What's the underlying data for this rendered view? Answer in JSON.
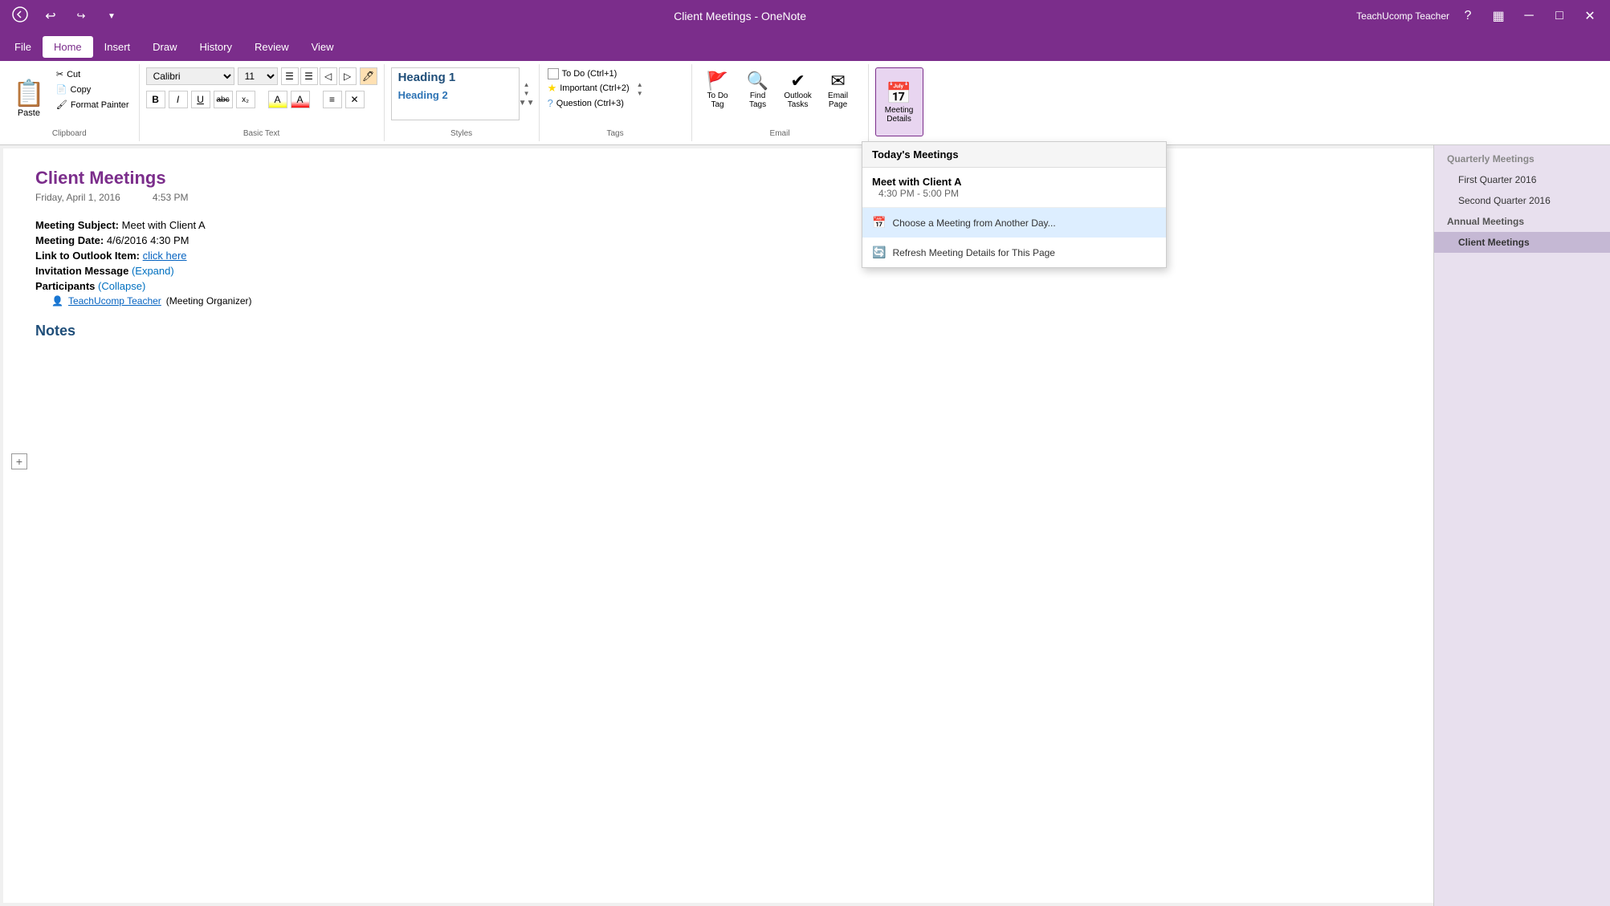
{
  "titlebar": {
    "title": "Client Meetings - OneNote",
    "user": "TeachUcomp Teacher",
    "back_icon": "◀",
    "forward_icon": "▶",
    "undo_icon": "↩",
    "help_icon": "?",
    "layout_icon": "▦",
    "minimize_icon": "─",
    "maximize_icon": "□",
    "close_icon": "✕"
  },
  "menubar": {
    "items": [
      "File",
      "Home",
      "Insert",
      "Draw",
      "History",
      "Review",
      "View"
    ]
  },
  "ribbon": {
    "clipboard": {
      "label": "Clipboard",
      "paste": "Paste",
      "cut": "Cut",
      "copy": "Copy",
      "format_painter": "Format Painter"
    },
    "basic_text": {
      "label": "Basic Text",
      "font": "Calibri",
      "size": "11",
      "bold": "B",
      "italic": "I",
      "underline": "U",
      "strikethrough": "abc",
      "subscript": "x₂",
      "list_bullet": "≡",
      "list_number": "≡",
      "indent_less": "◁",
      "indent_more": "▷",
      "clear_format": "✕",
      "highlight": "A",
      "font_color": "A",
      "align": "≡"
    },
    "styles": {
      "label": "Styles",
      "heading1": "Heading 1",
      "heading2": "Heading 2"
    },
    "tags": {
      "label": "Tags",
      "todo": "To Do (Ctrl+1)",
      "important": "Important (Ctrl+2)",
      "question": "Question (Ctrl+3)"
    },
    "email": {
      "label": "Email",
      "to_do_tag": "To Do\nTag",
      "find_tags": "Find\nTags",
      "outlook_tasks": "Outlook\nTasks",
      "email_page": "Email\nPage"
    },
    "meeting": {
      "label": "",
      "meeting_details": "Meeting\nDetails"
    }
  },
  "page": {
    "title": "Client Meetings",
    "date": "Friday, April 1, 2016",
    "time": "4:53 PM",
    "meeting_subject_label": "Meeting Subject:",
    "meeting_subject": "Meet with Client A",
    "meeting_date_label": "Meeting Date:",
    "meeting_date": "4/6/2016 4:30 PM",
    "outlook_link_label": "Link to Outlook Item:",
    "outlook_link": "click here",
    "invitation_label": "Invitation Message",
    "invitation_expand": "(Expand)",
    "participants_label": "Participants",
    "participants_collapse": "(Collapse)",
    "participant_name": "TeachUcomp Teacher",
    "participant_role": "(Meeting Organizer)",
    "notes_heading": "Notes"
  },
  "dropdown": {
    "header": "Today's Meetings",
    "meeting_title": "Meet with Client A",
    "meeting_time": "4:30 PM - 5:00 PM",
    "choose_label": "Choose a Meeting from Another Day...",
    "refresh_label": "Refresh Meeting Details for This Page"
  },
  "sidebar": {
    "items": [
      {
        "label": "Quarterly Meetings",
        "level": "parent",
        "selected": false
      },
      {
        "label": "First Quarter 2016",
        "level": "sub",
        "selected": false
      },
      {
        "label": "Second Quarter 2016",
        "level": "sub",
        "selected": false
      },
      {
        "label": "Annual Meetings",
        "level": "parent",
        "selected": false
      },
      {
        "label": "Client Meetings",
        "level": "sub",
        "selected": true
      }
    ]
  }
}
